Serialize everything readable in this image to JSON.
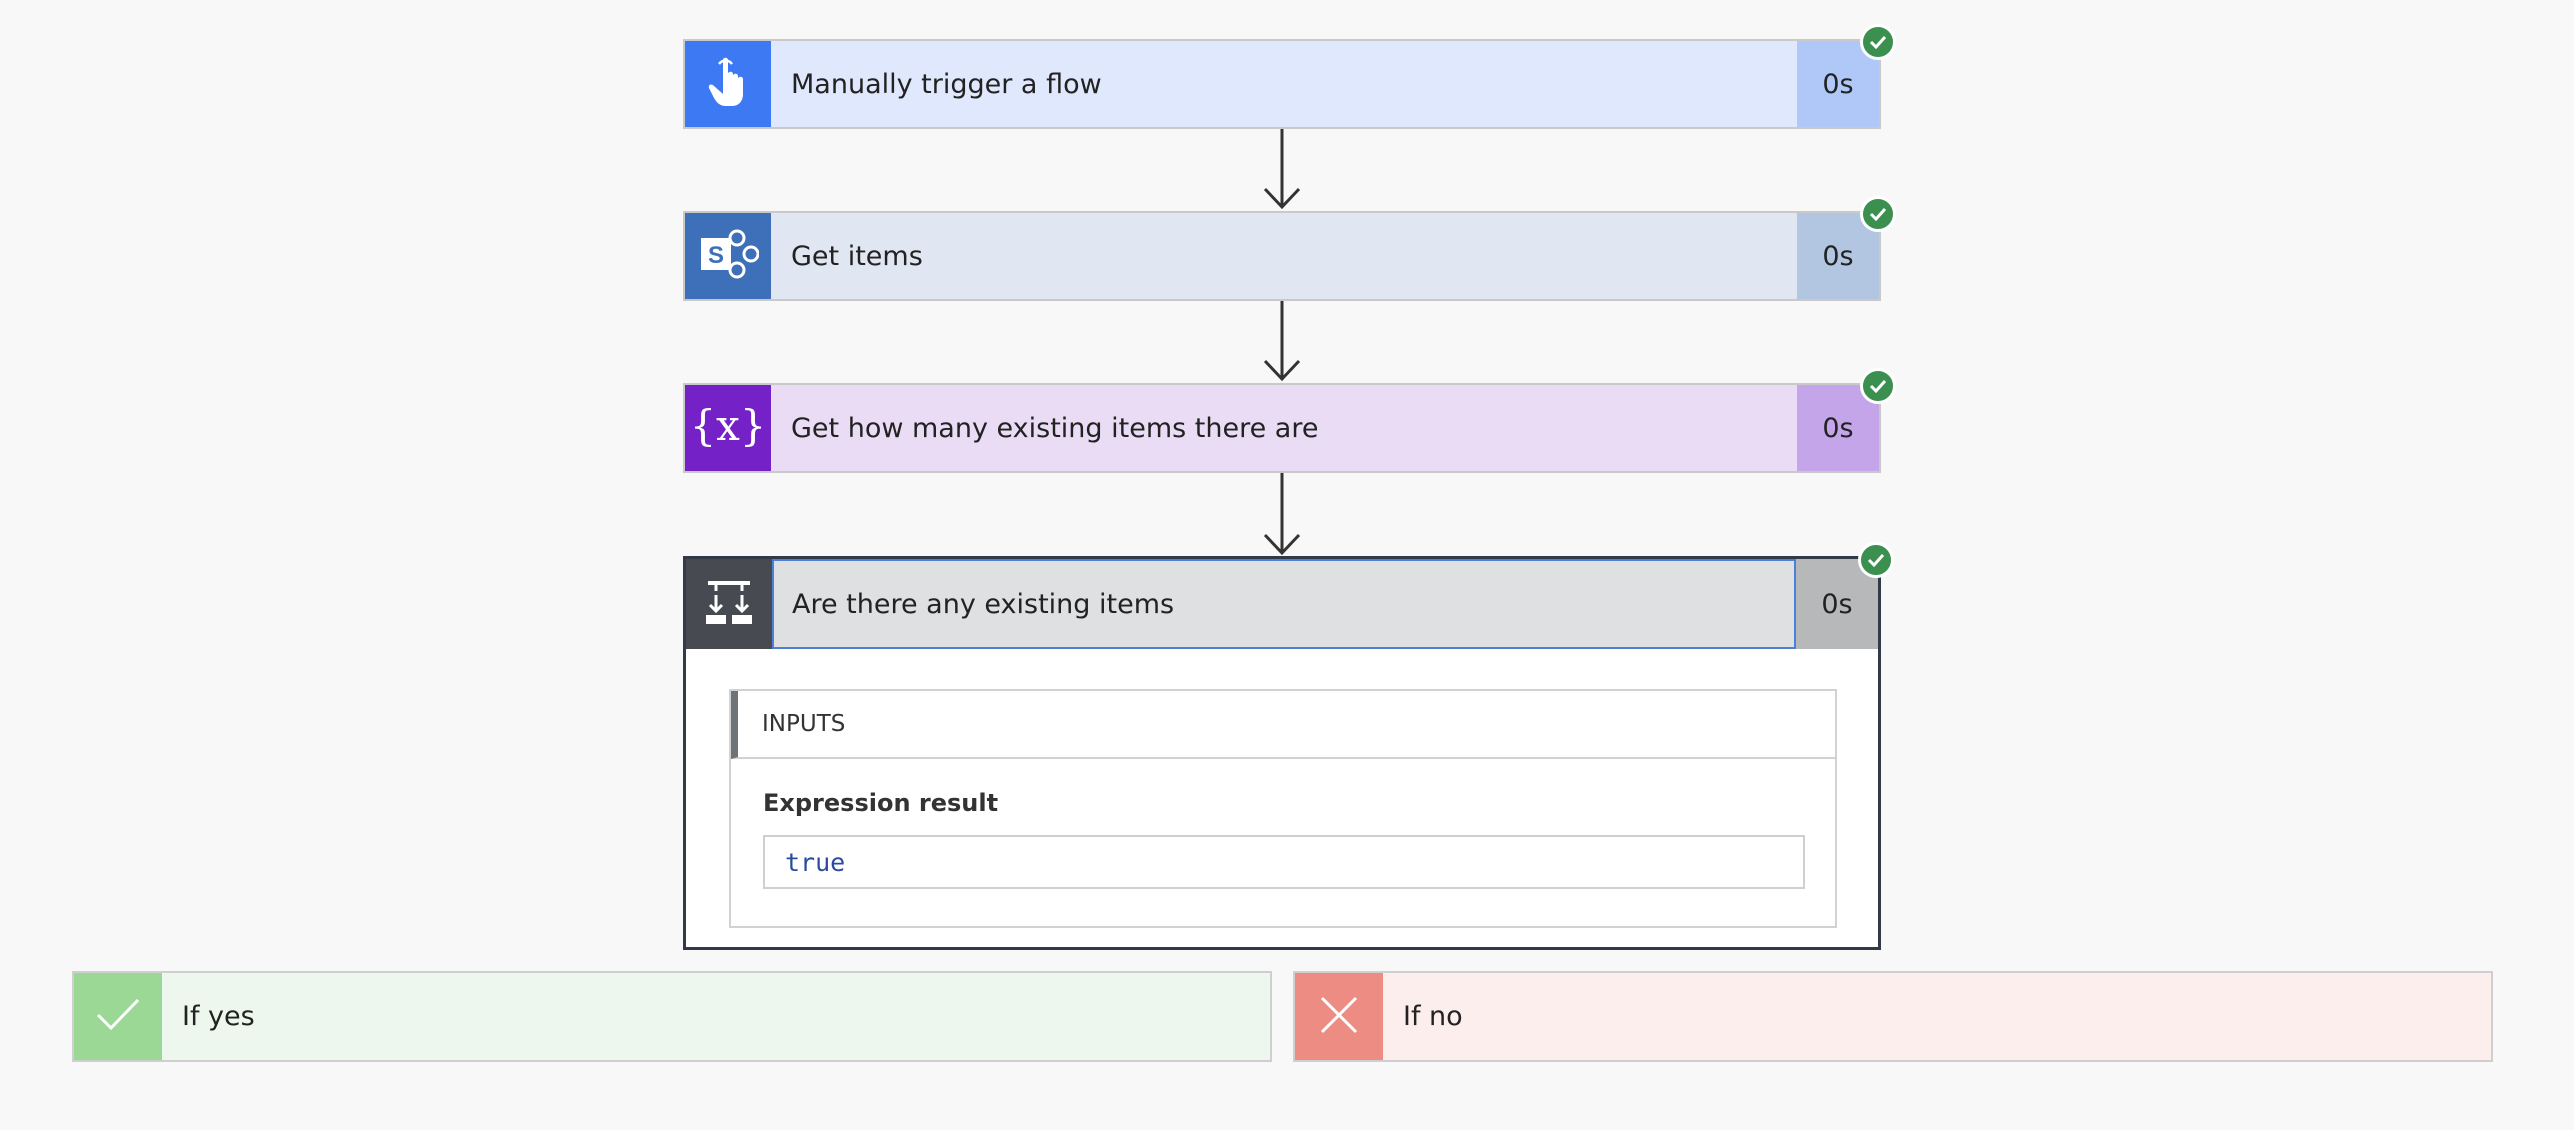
{
  "steps": [
    {
      "title": "Manually trigger a flow",
      "duration": "0s",
      "icon": "hand-pointer-icon",
      "icon_bg": "#3c79f3",
      "body_bg": "#e0e8fd",
      "dur_bg": "#afc8f7"
    },
    {
      "title": "Get items",
      "duration": "0s",
      "icon": "sharepoint-icon",
      "icon_bg": "#3d70b8",
      "body_bg": "#e1e7f2",
      "dur_bg": "#b2c6e2"
    },
    {
      "title": "Get how many existing items there are",
      "duration": "0s",
      "icon": "variable-icon",
      "icon_bg": "#7521c8",
      "body_bg": "#ebdcf6",
      "dur_bg": "#c5a5ea"
    }
  ],
  "condition": {
    "title": "Are there any existing items",
    "duration": "0s",
    "icon": "condition-icon",
    "inputs_label": "INPUTS",
    "expression_label": "Expression result",
    "expression_value": "true"
  },
  "branches": {
    "yes": {
      "label": "If yes",
      "icon": "checkmark-icon",
      "icon_bg": "#9bd895",
      "body_bg": "#eef7ee"
    },
    "no": {
      "label": "If no",
      "icon": "close-icon",
      "icon_bg": "#ed8c83",
      "body_bg": "#fceeed"
    }
  },
  "status_color": "#3b8f4f"
}
